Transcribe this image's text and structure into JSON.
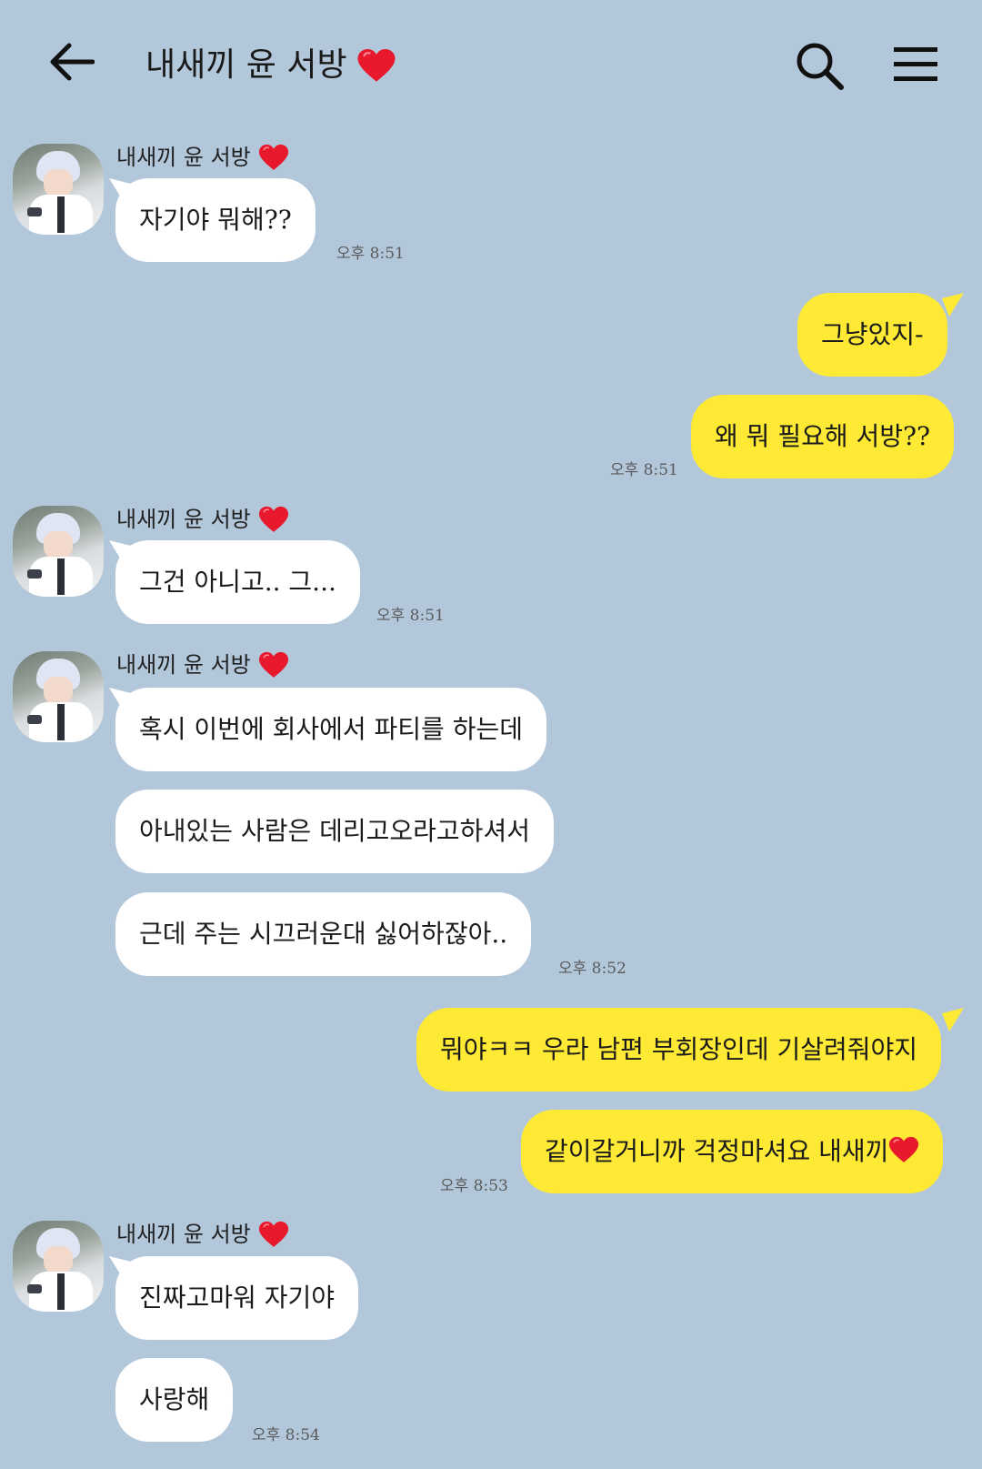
{
  "header": {
    "title": "내새끼 윤 서방"
  },
  "colors": {
    "background": "#b2c7da",
    "incoming_bubble": "#ffffff",
    "outgoing_bubble": "#fee934",
    "heart": "#e8192c"
  },
  "icons": [
    "back-arrow-icon",
    "search-icon",
    "menu-icon",
    "heart-icon"
  ],
  "messages": [
    {
      "sender": "내새끼 윤 서방",
      "direction": "in",
      "text": "자기야 뭐해??",
      "time": "오후 8:51"
    },
    {
      "direction": "out",
      "text": "그냥있지-"
    },
    {
      "direction": "out",
      "text": "왜 뭐 필요해 서방??",
      "time": "오후 8:51"
    },
    {
      "sender": "내새끼 윤 서방",
      "direction": "in",
      "text": "그건 아니고.. 그...",
      "time": "오후 8:51"
    },
    {
      "sender": "내새끼 윤 서방",
      "direction": "in",
      "text": "혹시 이번에 회사에서 파티를 하는데"
    },
    {
      "direction": "in",
      "text": "아내있는 사람은 데리고오라고하셔서"
    },
    {
      "direction": "in",
      "text": "근데 주는 시끄러운대 싫어하잖아..",
      "time": "오후 8:52"
    },
    {
      "direction": "out",
      "text": "뭐야ㅋㅋ 우라 남편 부회장인데 기살려줘야지"
    },
    {
      "direction": "out",
      "text": "같이갈거니까 걱정마셔요 내새끼",
      "time": "오후 8:53"
    },
    {
      "sender": "내새끼 윤 서방",
      "direction": "in",
      "text": "진짜고마워 자기야"
    },
    {
      "direction": "in",
      "text": "사랑해",
      "time": "오후 8:54"
    }
  ]
}
